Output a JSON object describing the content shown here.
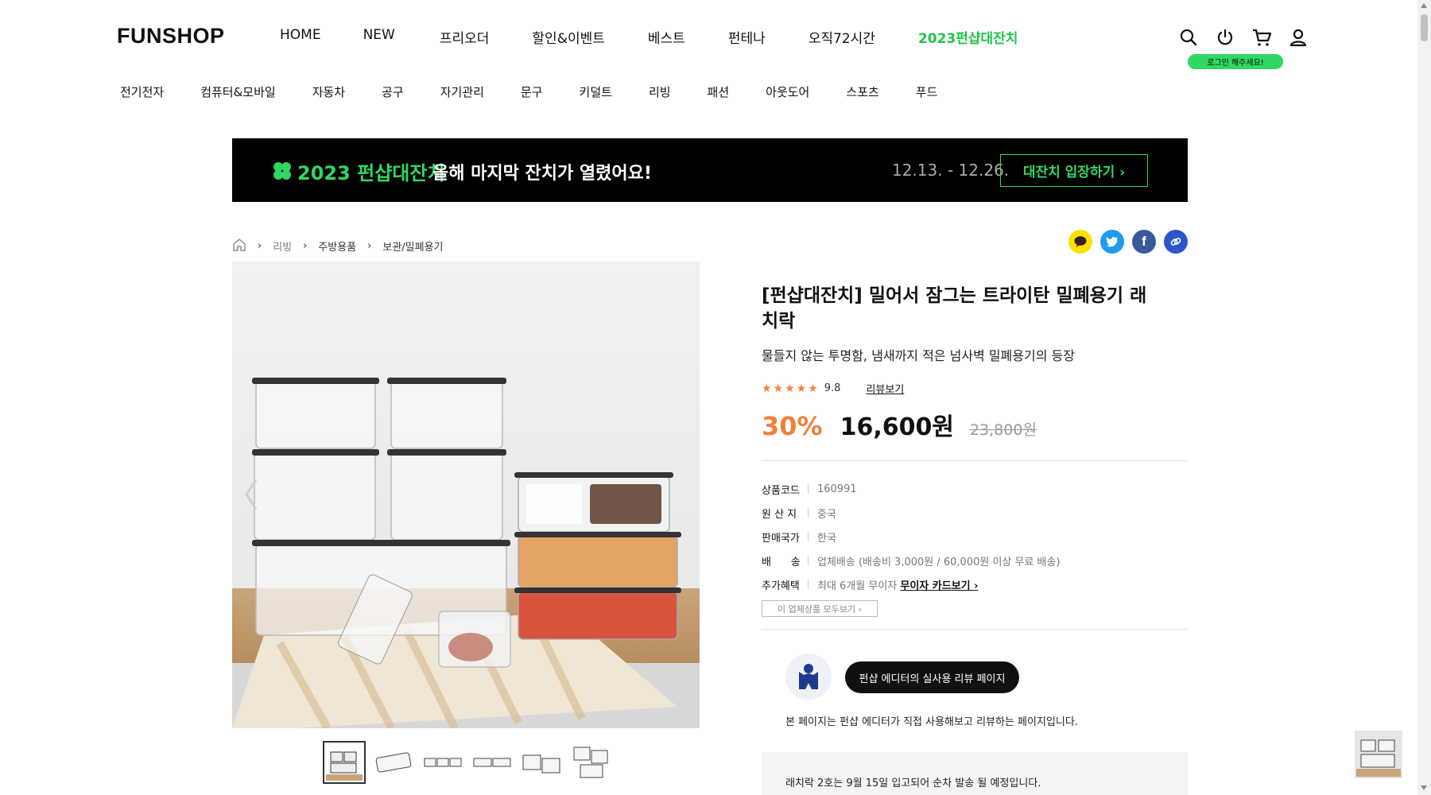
{
  "header": {
    "logo": "FUNSHOP",
    "gnb": [
      "HOME",
      "NEW",
      "프리오더",
      "할인&이벤트",
      "베스트",
      "펀테나",
      "오직72시간",
      "2023펀샵대잔치"
    ],
    "login_tip": "로그인 해주세요!"
  },
  "categories": [
    "전기전자",
    "컴퓨터&모바일",
    "자동차",
    "공구",
    "자기관리",
    "문구",
    "키덜트",
    "리빙",
    "패션",
    "아웃도어",
    "스포츠",
    "푸드"
  ],
  "banner": {
    "title": "2023 펀샵대잔치",
    "subtitle": "올해 마지막 잔치가 열렸어요!",
    "date": "12.13. - 12.26.",
    "button": "대잔치 입장하기 ›"
  },
  "breadcrumb": [
    "리빙",
    "주방용품",
    "보관/밀폐용기"
  ],
  "product": {
    "title": "[펀샵대잔치] 밀어서 잠그는 트라이탄 밀폐용기 래치락",
    "desc": "물들지 않는 투명함, 냄새까지 적은 넘사벽 밀폐용기의 등장",
    "stars": "★★★★★",
    "rating_value": 4.5,
    "score": "9.8",
    "review_link": "리뷰보기",
    "discount": "30%",
    "price": "16,600원",
    "original_price": "23,800원",
    "specs": [
      {
        "k": "상품코드",
        "v": "160991"
      },
      {
        "k": "원 산 지",
        "v": "중국"
      },
      {
        "k": "판매국가",
        "v": "한국"
      },
      {
        "k": "배      송",
        "v": "업체배송 (배송비 3,000원 / 60,000원 이상 무료 배송)"
      },
      {
        "k": "추가혜택",
        "v": "최대 6개월 무이자 ",
        "link": "무이자 카드보기 ›"
      }
    ],
    "seller_button": "이 업체상품 모두보기 ›",
    "editor_button": "펀샵 에디터의 실사용 리뷰 페이지",
    "editor_note": "본 페이지는 펀샵 에디터가 직접 사용해보고 리뷰하는 페이지입니다.",
    "notice": "래치락 2호는 9월 15일 입고되어 순차 발송 될 예정입니다."
  },
  "colors": {
    "accent_green": "#2fd862",
    "highlight_green": "#22c34a",
    "discount_orange": "#f2803a",
    "kakao": "#fae100",
    "twitter": "#1d9bf0",
    "facebook": "#1877f2",
    "link": "#2d56c9"
  }
}
